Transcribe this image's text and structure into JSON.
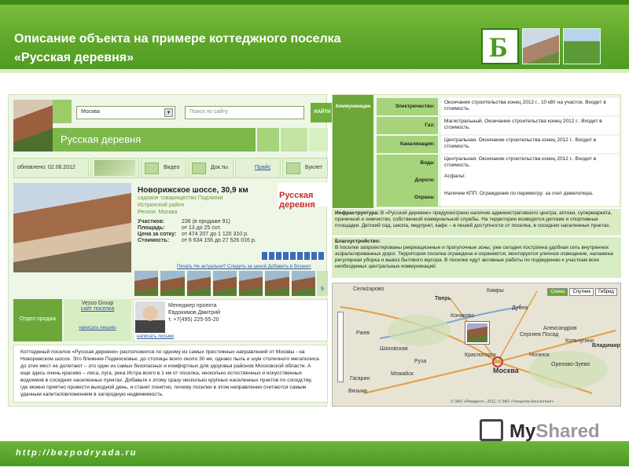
{
  "slide": {
    "title_line1": "Описание объекта на примере коттеджного поселка",
    "title_line2": "«Русская деревня»",
    "logo_letter": "Б",
    "footer_url": "http://bezpodryada.ru",
    "watermark_my": "My",
    "watermark_shared": "Shared"
  },
  "site": {
    "region_select": "Москва",
    "search_placeholder": "Поиск по сайту",
    "search_button": "НАЙТИ",
    "object_name": "Русская деревня",
    "updated": "обновлено: 02.06.2012",
    "tabs": [
      "Видео",
      "Док.ты",
      "Прайс",
      "Буклет"
    ],
    "highway": "Новорижское шоссе, 30,9 км",
    "settlement_type": "садовое товарищество Подлипки",
    "district": "Истринский район",
    "region": "Регион: Москва",
    "stats": [
      {
        "k": "Участков:",
        "v": "236 (в продаже 91)"
      },
      {
        "k": "Площадь:",
        "v": "от 13 до 25 сот."
      },
      {
        "k": "Цена за сотку:",
        "v": "от 474 207 до 1 120 310 р."
      },
      {
        "k": "Стоимость:",
        "v": "от 6 634 156 до 27 526 016 р."
      }
    ],
    "brand_name": "Русская деревня",
    "links": "Печать  Не актуально?  Следить за ценой  Добавить в блокнот",
    "photos_count": "9",
    "sales_dept": "Отдел продаж",
    "company": "Vesco Group",
    "company_site": "сайт поселка",
    "write_letter": "написать письмо",
    "manager_role": "Менеджер проекта",
    "manager_name": "Евдокимов Дмитрий",
    "manager_phone": "т. +7(495) 225-55-20",
    "description": "Коттеджный поселок «Русская деревня» расположился по одному из самых престижных направлений от Москвы - на Новорижском шоссе. Это ближнее Подмосковье, до столицы всего около 30 км, однако пыль и шум столичного мегаполиса до этих мест не долетают – это один из самых безопасных и комфортных для здоровья районов Московской области. А еще здесь очень красиво – леса, луга, река Истра всего в 1 км от поселка, несколько естественных и искусственных водоемов в соседних населенных пунктах. Добавьте к этому сразу несколько крупных населенных пунктов по соседству, где можно приятно провести выходной день, и станет понятно, почему поселки в этом направлении считаются самым удачным капиталовложением в загородную недвижимость."
  },
  "communications": {
    "header": "Коммуникации",
    "rows": [
      {
        "k": "Электричество:",
        "v": "Окончание строительства конец 2012 г.. 10 кВт на участок. Входит в стоимость."
      },
      {
        "k": "Газ:",
        "v": "Магистральный. Окончание строительства конец 2012 г.. Входит в стоимость."
      },
      {
        "k": "Канализация:",
        "v": "Центральная. Окончание строительства конец 2012 г.. Входит в стоимость."
      },
      {
        "k": "Вода:",
        "v": "Центральная. Окончание строительства конец 2012 г.. Входит в стоимость."
      },
      {
        "k": "Дороги:",
        "v": "Асфальт."
      },
      {
        "k": "Охрана:",
        "v": "Наличие КПП. Ограждение по периметру: за счет девелопера."
      }
    ],
    "infra_title": "Инфраструктура:",
    "infra_text": "В «Русской деревне» предусмотрено наличие административного центра, аптеки, супермаркета, прачечной и химчистки, собственной коммунальной службы. На территории возводятся детские и спортивные площадки. Детский сад, школа, медпункт, кафе – в пешей доступности от поселка, в соседних населенных пунктах.",
    "blago_title": "Благоустройство:",
    "blago_text": "В поселке запроектированы рекреационные и прогулочные зоны, уже сегодня построена удобная сеть внутренних асфальтированных дорог. Территория поселка ограждена и охраняется, монтируется уличное освещение, налажена регулярная уборка и вывоз бытового мусора. В поселке идут активные работы по подведению к участкам всех необходимых центральных коммуникаций."
  },
  "map": {
    "buttons": [
      "Схема",
      "Спутник",
      "Гибрид"
    ],
    "labels": [
      "Селиżарово",
      "Тверь",
      "Кимры",
      "Дубна",
      "Конаково",
      "Ржев",
      "Сергиев Посад",
      "Александров",
      "Кольчугино",
      "Владимир",
      "Шаховская",
      "Красногорск",
      "Москва",
      "Орехово-Зуево",
      "Ногинск",
      "Руза",
      "Можайск",
      "Гагарин",
      "Вязьма"
    ],
    "copyright": "© ЗАО «Резидент», 2011, © ЗАО «Геоцентр-Консалтинг»"
  }
}
